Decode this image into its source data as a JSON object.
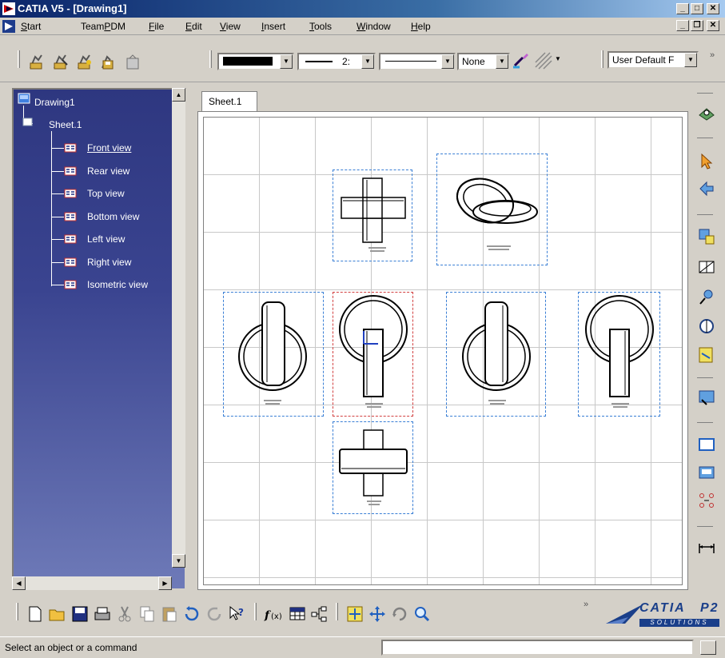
{
  "window": {
    "title": "CATIA V5 - [Drawing1]"
  },
  "menu": {
    "items": [
      {
        "label": "Start",
        "underline": "S",
        "rest": "tart"
      },
      {
        "label": "TeamPDM",
        "pre": "Team",
        "underline": "P",
        "rest": "DM"
      },
      {
        "label": "File",
        "underline": "F",
        "rest": "ile"
      },
      {
        "label": "Edit",
        "underline": "E",
        "rest": "dit"
      },
      {
        "label": "View",
        "underline": "V",
        "rest": "iew"
      },
      {
        "label": "Insert",
        "underline": "I",
        "rest": "nsert"
      },
      {
        "label": "Tools",
        "underline": "T",
        "rest": "ools"
      },
      {
        "label": "Window",
        "underline": "W",
        "rest": "indow"
      },
      {
        "label": "Help",
        "underline": "H",
        "rest": "elp"
      }
    ]
  },
  "graphic_props": {
    "line_thickness": "2:",
    "pattern_value": "None",
    "style_value": "User Default F"
  },
  "tree": {
    "root": "Drawing1",
    "sheet": "Sheet.1",
    "views": [
      "Front view",
      "Rear view",
      "Top view",
      "Bottom view",
      "Left view",
      "Right view",
      "Isometric view"
    ]
  },
  "sheet_tab": "Sheet.1",
  "status": {
    "message": "Select an object or a command"
  },
  "logo": {
    "brand": "CATIA",
    "tag": "P2",
    "sub": "SOLUTIONS"
  },
  "colors": {
    "view_frame": "#3a7fd5",
    "active_frame": "#d24040",
    "tree_bg": "#2e3780"
  }
}
